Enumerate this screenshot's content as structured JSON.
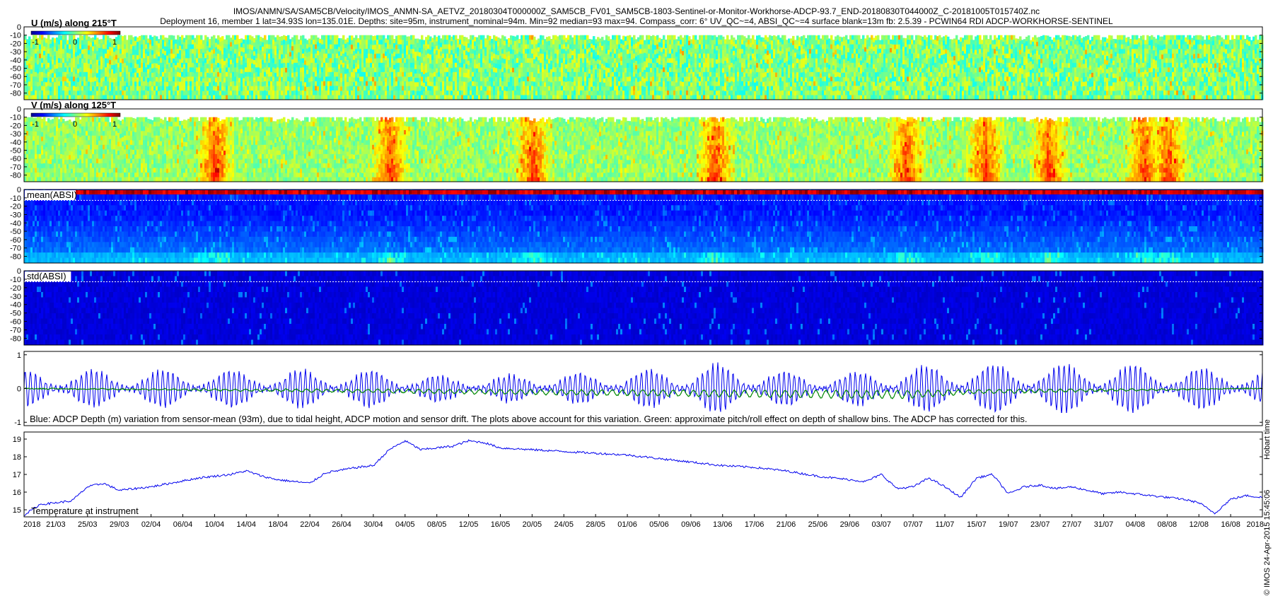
{
  "header": {
    "line1": "IMOS/ANMN/SA/SAM5CB/Velocity/IMOS_ANMN-SA_AETVZ_20180304T000000Z_SAM5CB_FV01_SAM5CB-1803-Sentinel-or-Monitor-Workhorse-ADCP-93.7_END-20180830T044000Z_C-20181005T015740Z.nc",
    "line2": "Deployment 16, member 1 lat=34.93S lon=135.01E. Depths: site=95m, instrument_nominal=94m. Min=92 median=93 max=94. Compass_corr: 6° UV_QC~=4, ABSI_QC~=4 surface blank=13m fb: 2.5.39 - PCWIN64 RDI ADCP-WORKHORSE-SENTINEL"
  },
  "side_credits": {
    "tz": "Hobart time",
    "imos": "© IMOS 24-Apr-2015 15:45:06"
  },
  "colors": {
    "blue_trace": "#0000ee",
    "green_trace": "#008800",
    "jet_low": "#00008f",
    "jet_high": "#800000",
    "dashed_line": "#ffffff"
  },
  "chart_data": [
    {
      "type": "heatmap",
      "panel": "u",
      "label": "U (m/s) along 215°T",
      "colorbar": {
        "ticks": [
          "-1",
          "0",
          "1"
        ],
        "range": [
          -1,
          1
        ]
      },
      "y_ticks": [
        "0",
        "-10",
        "-20",
        "-30",
        "-40",
        "-50",
        "-60",
        "-70",
        "-80"
      ],
      "ylim": [
        -88,
        0
      ],
      "description_values": {
        "blank_top_depth": -10,
        "dominant_value": 0
      }
    },
    {
      "type": "heatmap",
      "panel": "v",
      "label": "V (m/s) along 125°T",
      "colorbar": {
        "ticks": [
          "-1",
          "0",
          "1"
        ],
        "range": [
          -1,
          1
        ]
      },
      "y_ticks": [
        "0",
        "-10",
        "-20",
        "-30",
        "-40",
        "-50",
        "-60",
        "-70",
        "-80"
      ],
      "ylim": [
        -88,
        0
      ],
      "warm_band_dates": [
        "10/04",
        "02/05",
        "20/05",
        "12/06",
        "06/07",
        "16/07",
        "24/07",
        "05/08",
        "08/08"
      ]
    },
    {
      "type": "heatmap",
      "panel": "mean_absi",
      "label": "mean(ABSI)",
      "y_ticks": [
        "0",
        "-10",
        "-20",
        "-30",
        "-40",
        "-50",
        "-60",
        "-70",
        "-80"
      ],
      "ylim": [
        -88,
        0
      ],
      "dashed_depth": -13
    },
    {
      "type": "heatmap",
      "panel": "std_absi",
      "label": "std(ABSI)",
      "y_ticks": [
        "0",
        "-10",
        "-20",
        "-30",
        "-40",
        "-50",
        "-60",
        "-70",
        "-80"
      ],
      "ylim": [
        -88,
        0
      ],
      "dashed_depth": -13
    },
    {
      "type": "line",
      "panel": "depth_variation",
      "y_ticks": [
        "1",
        "0",
        "-1"
      ],
      "ylim": [
        -1.1,
        1.1
      ],
      "caption": "Blue: ADCP Depth (m) variation from sensor-mean (93m), due to tidal height, ADCP motion and sensor drift. The plots above account for this variation. Green: approximate pitch/roll effect on depth of shallow bins. The ADCP has corrected for this.",
      "series": [
        {
          "color": "blue",
          "amplitude_by_date": [
            [
              "17/03",
              0.55
            ],
            [
              "30/04",
              0.55
            ],
            [
              "10/05",
              0.35
            ],
            [
              "01/06",
              0.5
            ],
            [
              "12/06",
              0.75
            ],
            [
              "25/06",
              0.4
            ],
            [
              "10/07",
              0.7
            ],
            [
              "31/07",
              0.75
            ],
            [
              "18/08",
              0.55
            ]
          ]
        },
        {
          "color": "green",
          "offset_by_date": [
            [
              "17/03",
              0
            ],
            [
              "05/07",
              -0.3
            ],
            [
              "15/07",
              -0.15
            ],
            [
              "26/07",
              -0.1
            ],
            [
              "08/08",
              -0.05
            ],
            [
              "18/08",
              0
            ]
          ]
        }
      ]
    },
    {
      "type": "line",
      "panel": "temperature",
      "label": "Temperature at instrument",
      "y_ticks": [
        "19",
        "18",
        "17",
        "16",
        "15"
      ],
      "ylim": [
        14.6,
        19.4
      ],
      "x_year_labels": [
        "2018",
        "2018"
      ],
      "x_ticks": [
        "21/03",
        "25/03",
        "29/03",
        "02/04",
        "06/04",
        "10/04",
        "14/04",
        "18/04",
        "22/04",
        "26/04",
        "30/04",
        "04/05",
        "08/05",
        "12/05",
        "16/05",
        "20/05",
        "24/05",
        "28/05",
        "01/06",
        "05/06",
        "09/06",
        "13/06",
        "17/06",
        "21/06",
        "25/06",
        "29/06",
        "03/07",
        "07/07",
        "11/07",
        "15/07",
        "19/07",
        "23/07",
        "27/07",
        "31/07",
        "04/08",
        "08/08",
        "12/08",
        "16/08"
      ],
      "points": [
        [
          "17/03",
          14.7
        ],
        [
          "19/03",
          15.3
        ],
        [
          "23/03",
          15.5
        ],
        [
          "25/03",
          16.3
        ],
        [
          "27/03",
          16.5
        ],
        [
          "29/03",
          16.1
        ],
        [
          "02/04",
          16.3
        ],
        [
          "08/04",
          16.8
        ],
        [
          "12/04",
          17.0
        ],
        [
          "14/04",
          17.2
        ],
        [
          "16/04",
          16.9
        ],
        [
          "18/04",
          16.7
        ],
        [
          "20/04",
          16.6
        ],
        [
          "22/04",
          16.5
        ],
        [
          "24/04",
          17.1
        ],
        [
          "28/04",
          17.4
        ],
        [
          "30/04",
          17.5
        ],
        [
          "02/05",
          18.4
        ],
        [
          "04/05",
          18.9
        ],
        [
          "06/05",
          18.4
        ],
        [
          "08/05",
          18.5
        ],
        [
          "10/05",
          18.6
        ],
        [
          "12/05",
          18.9
        ],
        [
          "14/05",
          18.8
        ],
        [
          "16/05",
          18.5
        ],
        [
          "20/05",
          18.4
        ],
        [
          "24/05",
          18.3
        ],
        [
          "28/05",
          18.2
        ],
        [
          "01/06",
          18.1
        ],
        [
          "05/06",
          17.9
        ],
        [
          "09/06",
          17.7
        ],
        [
          "13/06",
          17.5
        ],
        [
          "17/06",
          17.4
        ],
        [
          "21/06",
          17.2
        ],
        [
          "25/06",
          16.9
        ],
        [
          "29/06",
          16.7
        ],
        [
          "01/07",
          16.6
        ],
        [
          "03/07",
          17.0
        ],
        [
          "05/07",
          16.2
        ],
        [
          "07/07",
          16.3
        ],
        [
          "09/07",
          16.8
        ],
        [
          "11/07",
          16.3
        ],
        [
          "13/07",
          15.7
        ],
        [
          "15/07",
          16.8
        ],
        [
          "17/07",
          17.0
        ],
        [
          "19/07",
          15.9
        ],
        [
          "21/07",
          16.3
        ],
        [
          "23/07",
          16.4
        ],
        [
          "25/07",
          16.2
        ],
        [
          "27/07",
          16.3
        ],
        [
          "29/07",
          16.1
        ],
        [
          "31/07",
          15.9
        ],
        [
          "02/08",
          16.0
        ],
        [
          "04/08",
          15.9
        ],
        [
          "06/08",
          15.8
        ],
        [
          "08/08",
          15.7
        ],
        [
          "10/08",
          15.6
        ],
        [
          "12/08",
          15.4
        ],
        [
          "14/08",
          14.8
        ],
        [
          "16/08",
          15.6
        ],
        [
          "18/08",
          15.8
        ],
        [
          "20/08",
          15.7
        ]
      ]
    }
  ]
}
